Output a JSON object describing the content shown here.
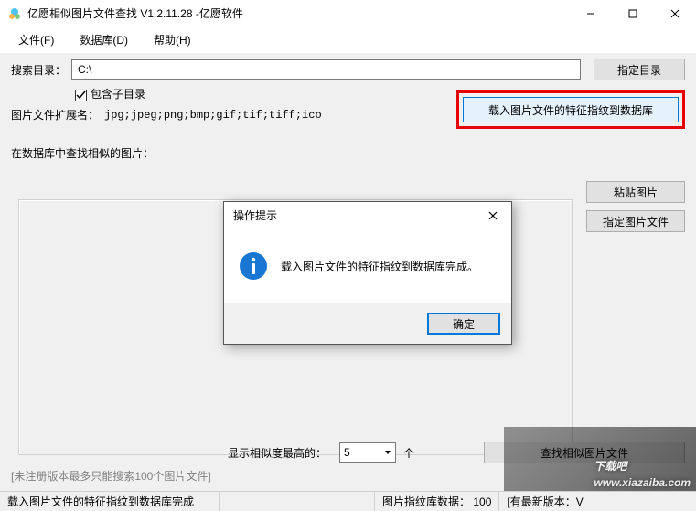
{
  "window": {
    "title": "亿愿相似图片文件查找 V1.2.11.28 -亿愿软件"
  },
  "menu": {
    "file": "文件(F)",
    "database": "数据库(D)",
    "help": "帮助(H)"
  },
  "search": {
    "label": "搜索目录：",
    "path": "C:\\",
    "browse_btn": "指定目录",
    "include_sub_label": "包含子目录",
    "ext_label": "图片文件扩展名：",
    "ext_value": "jpg;jpeg;png;bmp;gif;tif;tiff;ico",
    "load_btn": "载入图片文件的特征指纹到数据库"
  },
  "find": {
    "label": "在数据库中查找相似的图片：",
    "paste_btn": "粘贴图片",
    "pick_btn": "指定图片文件"
  },
  "bottom": {
    "similarity_label": "显示相似度最高的：",
    "similarity_value": "5",
    "unit": "个",
    "search_btn": "查找相似图片文件",
    "unregistered": "[未注册版本最多只能搜索100个图片文件]"
  },
  "status": {
    "seg1": "载入图片文件的特征指纹到数据库完成",
    "seg2_label": "图片指纹库数据：",
    "seg2_value": "100",
    "seg3_label": "[有最新版本：V"
  },
  "dialog": {
    "title": "操作提示",
    "message": "载入图片文件的特征指纹到数据库完成。",
    "ok": "确定"
  },
  "watermark": {
    "brand": "下载吧",
    "url": "www.xiazaiba.com"
  }
}
